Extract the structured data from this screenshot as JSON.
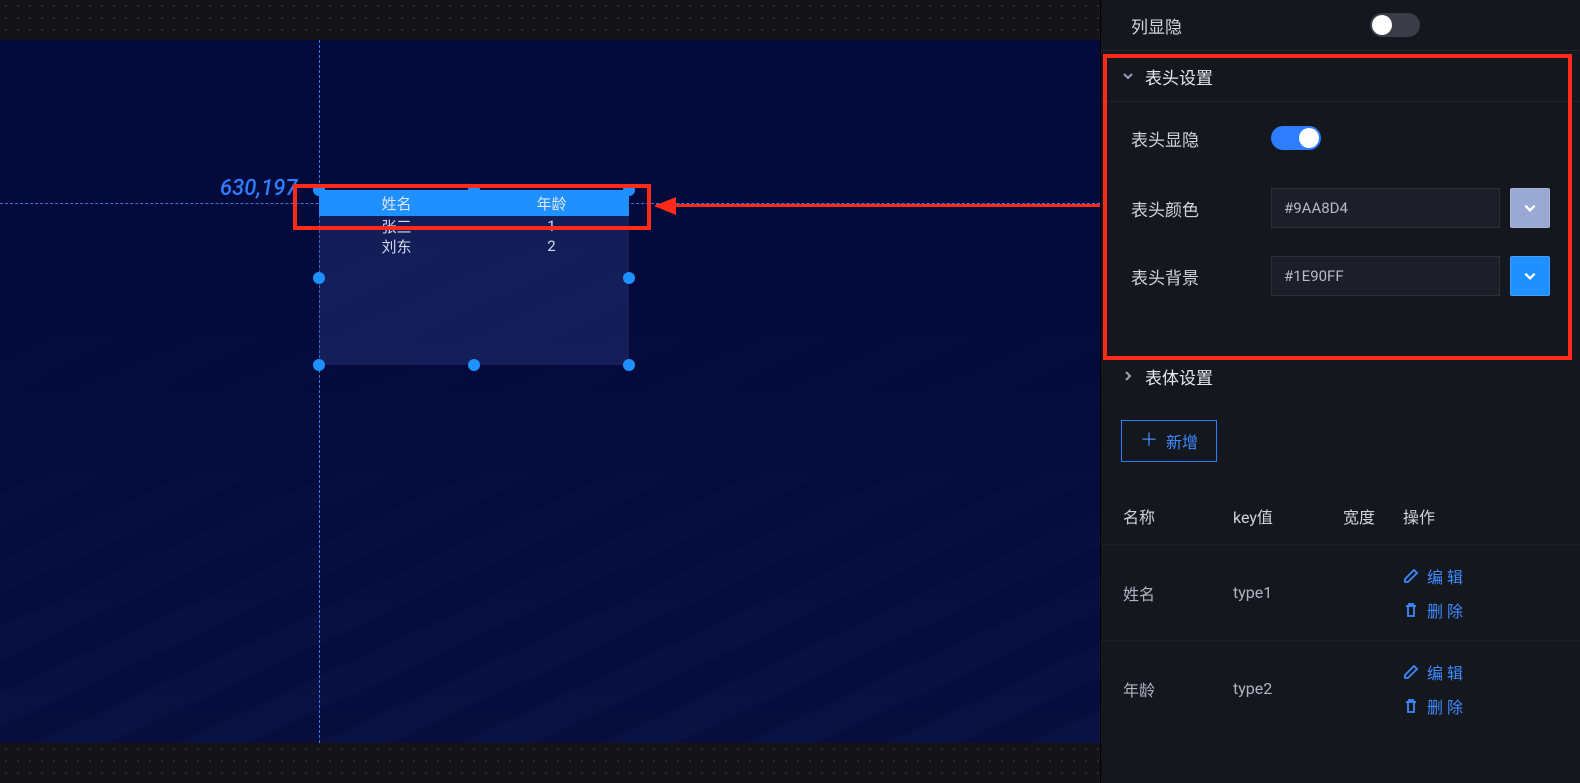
{
  "canvas": {
    "coord_label": "630,197",
    "table": {
      "header": [
        "姓名",
        "年龄"
      ],
      "rows": [
        [
          "张三",
          "1"
        ],
        [
          "刘东",
          "2"
        ]
      ],
      "header_bg": "#1E90FF"
    }
  },
  "panel": {
    "col_visibility_label": "列显隐",
    "header_section_label": "表头设置",
    "header_visible_label": "表头显隐",
    "header_color_label": "表头颜色",
    "header_color_value": "#9AA8D4",
    "header_bg_label": "表头背景",
    "header_bg_value": "#1E90FF",
    "body_section_label": "表体设置",
    "add_label": "新增",
    "table_headers": {
      "name": "名称",
      "key": "key值",
      "width": "宽度",
      "ops": "操作"
    },
    "edit_label": "编辑",
    "delete_label": "删除",
    "rows": [
      {
        "name": "姓名",
        "key": "type1",
        "width": ""
      },
      {
        "name": "年龄",
        "key": "type2",
        "width": ""
      }
    ]
  },
  "colors": {
    "header_color_swatch": "#9AA8D4",
    "header_bg_swatch": "#1E90FF"
  }
}
